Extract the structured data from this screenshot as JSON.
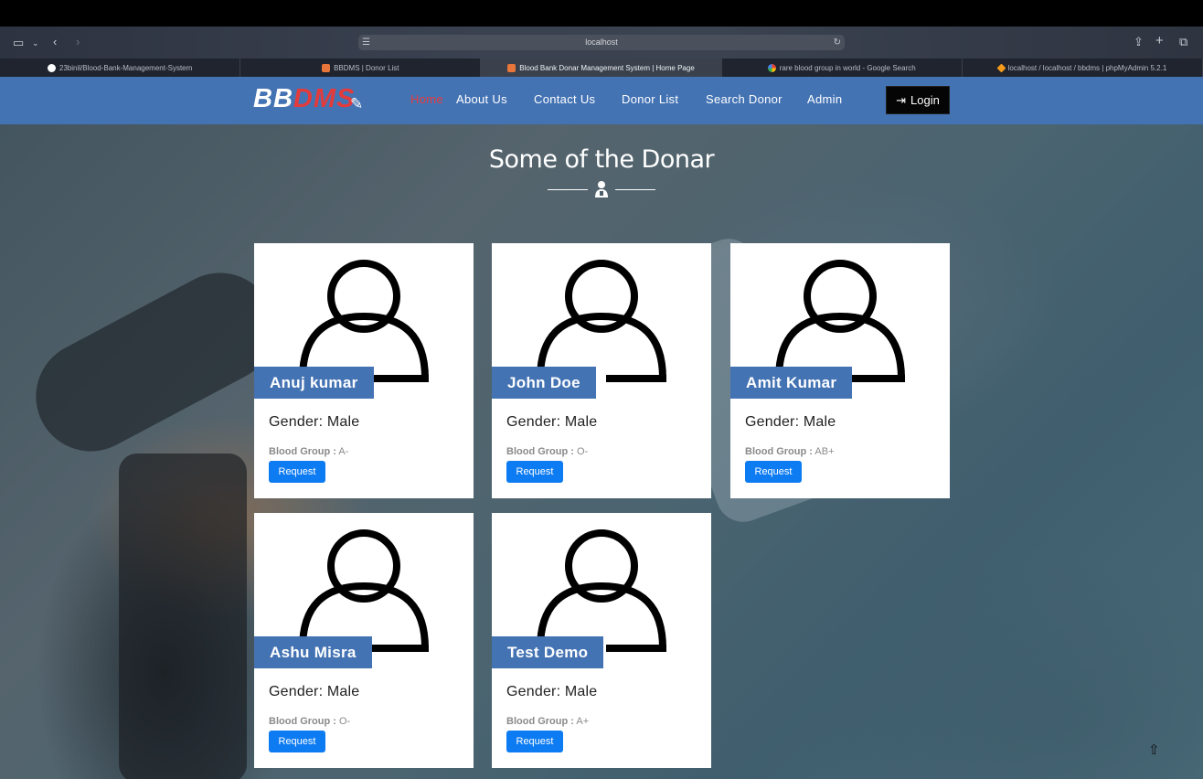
{
  "browser": {
    "url": "localhost",
    "tabs": [
      {
        "label": "23binil/Blood-Bank-Management-System",
        "icon": "github-icon",
        "active": false
      },
      {
        "label": "BBDMS | Donor List",
        "icon": "site-icon",
        "active": false
      },
      {
        "label": "Blood Bank Donar Management System | Home Page",
        "icon": "site-icon",
        "active": true
      },
      {
        "label": "rare blood group in world - Google Search",
        "icon": "google-icon",
        "active": false
      },
      {
        "label": "localhost / localhost / bbdms | phpMyAdmin 5.2.1",
        "icon": "phpmyadmin-icon",
        "active": false
      }
    ]
  },
  "nav": {
    "brand_bb": "BB",
    "brand_dms": "DMS",
    "items": [
      "Home",
      "About Us",
      "Contact Us",
      "Donor List",
      "Search Donor",
      "Admin"
    ],
    "login": "Login"
  },
  "section": {
    "title": "Some of the Donar"
  },
  "donors": [
    {
      "name": "Anuj kumar",
      "gender": "Gender: Male",
      "blood_label": "Blood Group :",
      "blood": "A-",
      "button": "Request"
    },
    {
      "name": "John Doe",
      "gender": "Gender: Male",
      "blood_label": "Blood Group :",
      "blood": "O-",
      "button": "Request"
    },
    {
      "name": "Amit Kumar",
      "gender": "Gender: Male",
      "blood_label": "Blood Group :",
      "blood": "AB+",
      "button": "Request"
    },
    {
      "name": "Ashu Misra",
      "gender": "Gender: Male",
      "blood_label": "Blood Group :",
      "blood": "O-",
      "button": "Request"
    },
    {
      "name": "Test Demo",
      "gender": "Gender: Male",
      "blood_label": "Blood Group :",
      "blood": "A+",
      "button": "Request"
    }
  ],
  "colors": {
    "nav_bg": "#4473b4",
    "brand_accent": "#e33b3b",
    "request_button": "#0d7bf2"
  }
}
